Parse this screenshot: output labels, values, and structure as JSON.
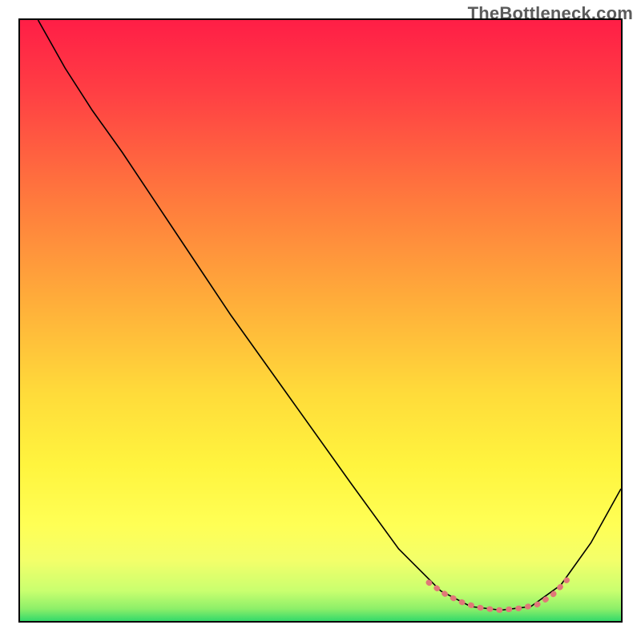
{
  "watermark": "TheBottleneck.com",
  "chart_data": {
    "type": "line",
    "title": "",
    "xlabel": "",
    "ylabel": "",
    "xlim": [
      0,
      100
    ],
    "ylim": [
      0,
      100
    ],
    "gradient_stops": [
      {
        "offset": 0,
        "color": "#ff1e46"
      },
      {
        "offset": 12,
        "color": "#ff3f44"
      },
      {
        "offset": 30,
        "color": "#ff7a3d"
      },
      {
        "offset": 48,
        "color": "#ffb13a"
      },
      {
        "offset": 62,
        "color": "#ffdb3a"
      },
      {
        "offset": 74,
        "color": "#fff43e"
      },
      {
        "offset": 84,
        "color": "#ffff55"
      },
      {
        "offset": 90,
        "color": "#f3ff6a"
      },
      {
        "offset": 95,
        "color": "#c9ff6f"
      },
      {
        "offset": 98,
        "color": "#8cef69"
      },
      {
        "offset": 100,
        "color": "#34d96a"
      }
    ],
    "series": [
      {
        "name": "bottleneck-curve",
        "color": "#000000",
        "width": 1.6,
        "points": [
          {
            "x": 3.0,
            "y": 100.0
          },
          {
            "x": 7.5,
            "y": 92.0
          },
          {
            "x": 12.0,
            "y": 85.0
          },
          {
            "x": 17.0,
            "y": 78.0
          },
          {
            "x": 25.0,
            "y": 66.0
          },
          {
            "x": 35.0,
            "y": 51.0
          },
          {
            "x": 45.0,
            "y": 37.0
          },
          {
            "x": 55.0,
            "y": 23.0
          },
          {
            "x": 63.0,
            "y": 12.0
          },
          {
            "x": 70.0,
            "y": 5.0
          },
          {
            "x": 75.0,
            "y": 2.4
          },
          {
            "x": 80.0,
            "y": 1.8
          },
          {
            "x": 85.0,
            "y": 2.4
          },
          {
            "x": 90.0,
            "y": 6.0
          },
          {
            "x": 95.0,
            "y": 13.0
          },
          {
            "x": 100.0,
            "y": 22.0
          }
        ]
      }
    ],
    "highlight": {
      "name": "optimal-range",
      "color": "#e07878",
      "stroke_width": 7,
      "dash": "1 11",
      "points": [
        {
          "x": 68.0,
          "y": 6.4
        },
        {
          "x": 71.0,
          "y": 4.3
        },
        {
          "x": 74.0,
          "y": 2.9
        },
        {
          "x": 77.0,
          "y": 2.1
        },
        {
          "x": 80.0,
          "y": 1.8
        },
        {
          "x": 83.0,
          "y": 2.1
        },
        {
          "x": 86.0,
          "y": 2.7
        },
        {
          "x": 88.5,
          "y": 4.2
        },
        {
          "x": 91.0,
          "y": 6.8
        }
      ]
    }
  }
}
